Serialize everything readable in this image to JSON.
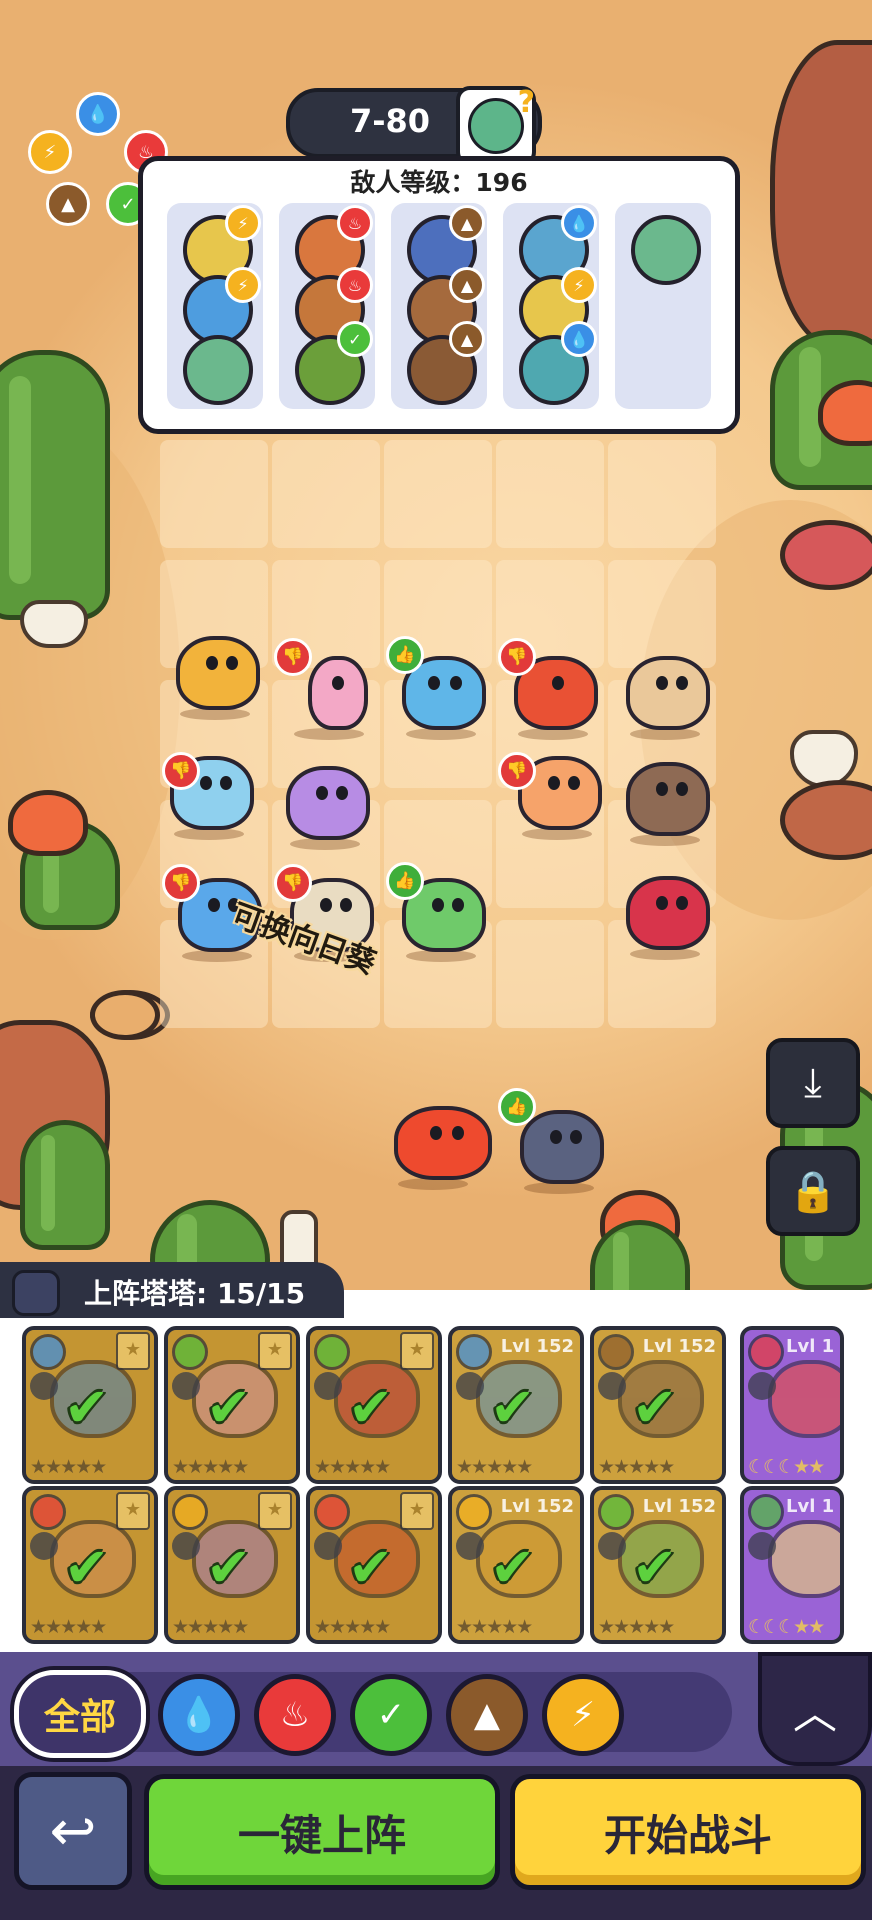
{
  "stage": {
    "label": "7-80"
  },
  "enemy_panel": {
    "level_text": "敌人等级：196",
    "waves": [
      {
        "enemies": [
          {
            "icon": "yellow-mage-enemy",
            "element": "lightning"
          },
          {
            "icon": "blue-fish-enemy",
            "element": "lightning"
          },
          {
            "icon": "green-zombie-enemy",
            "element": ""
          }
        ]
      },
      {
        "enemies": [
          {
            "icon": "orange-bandit-enemy",
            "element": "fire"
          },
          {
            "icon": "brown-cookie-enemy",
            "element": "fire"
          },
          {
            "icon": "green-plant-enemy",
            "element": "leaf"
          }
        ]
      },
      {
        "enemies": [
          {
            "icon": "blue-wizard-enemy",
            "element": "earth"
          },
          {
            "icon": "cowboy-enemy",
            "element": "earth"
          },
          {
            "icon": "brown-mouth-enemy",
            "element": "earth"
          }
        ]
      },
      {
        "enemies": [
          {
            "icon": "blue-zombie-enemy",
            "element": "water"
          },
          {
            "icon": "yellow-mage-enemy",
            "element": "lightning"
          },
          {
            "icon": "teal-ghoul-enemy",
            "element": "water"
          }
        ]
      },
      {
        "enemies": [
          {
            "icon": "green-zombie-enemy",
            "element": ""
          }
        ]
      }
    ]
  },
  "hint_text": "可换向日葵",
  "roster": {
    "label": "上阵塔塔: 15/15"
  },
  "cards": [
    {
      "level": "",
      "element": "water",
      "starred": true
    },
    {
      "level": "",
      "element": "leaf",
      "starred": true
    },
    {
      "level": "",
      "element": "leaf",
      "starred": true
    },
    {
      "level": "Lvl 152",
      "element": "water",
      "starred": false
    },
    {
      "level": "Lvl 152",
      "element": "earth",
      "starred": false
    },
    {
      "level": "Lvl 1",
      "element": "fire",
      "starred": false
    },
    {
      "level": "",
      "element": "fire",
      "starred": true
    },
    {
      "level": "",
      "element": "lightning",
      "starred": true
    },
    {
      "level": "",
      "element": "fire",
      "starred": true
    },
    {
      "level": "Lvl 152",
      "element": "lightning",
      "starred": false
    },
    {
      "level": "Lvl 152",
      "element": "leaf",
      "starred": false
    },
    {
      "level": "Lvl 1",
      "element": "leaf",
      "starred": false
    }
  ],
  "filters": {
    "all_label": "全部"
  },
  "buttons": {
    "auto_deploy": "一键上阵",
    "start_battle": "开始战斗"
  },
  "colors": {
    "water": "#3a8fe6",
    "fire": "#e93a3a",
    "leaf": "#4cbf3b",
    "earth": "#8b5a2b",
    "lightning": "#f5b21f",
    "accent_green": "#6fd63a",
    "accent_yellow": "#ffd33c"
  }
}
